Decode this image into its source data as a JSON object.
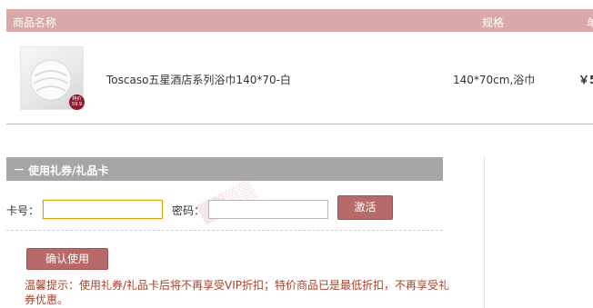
{
  "cart_table": {
    "headers": {
      "name": "商品名称",
      "spec": "规格",
      "price": "单"
    },
    "item": {
      "name": "Toscaso五星酒店系列浴巾140*70-白",
      "spec": "140*70cm,浴巾",
      "price": "￥5",
      "thumb_badge_line1": "特价",
      "thumb_badge_line2": "59.9"
    }
  },
  "gift_card": {
    "collapse_symbol": "－",
    "title": "使用礼券/礼品卡",
    "card_label": "卡号：",
    "card_value": "",
    "password_label": "密码：",
    "password_value": "",
    "activate_label": "激活",
    "confirm_label": "确认使用",
    "tip": "温馨提示：使用礼券/礼品卡后将不再享受VIP折扣；特价商品已是最低折扣，不再享受礼券优惠。"
  },
  "colors": {
    "header_bg": "#d9a8a8",
    "section_bg": "#a6a6a6",
    "button_bg": "#b86a6a",
    "tip_text": "#a2422c"
  },
  "icons": {
    "collapse": "minus-icon",
    "product": "towel-image"
  }
}
